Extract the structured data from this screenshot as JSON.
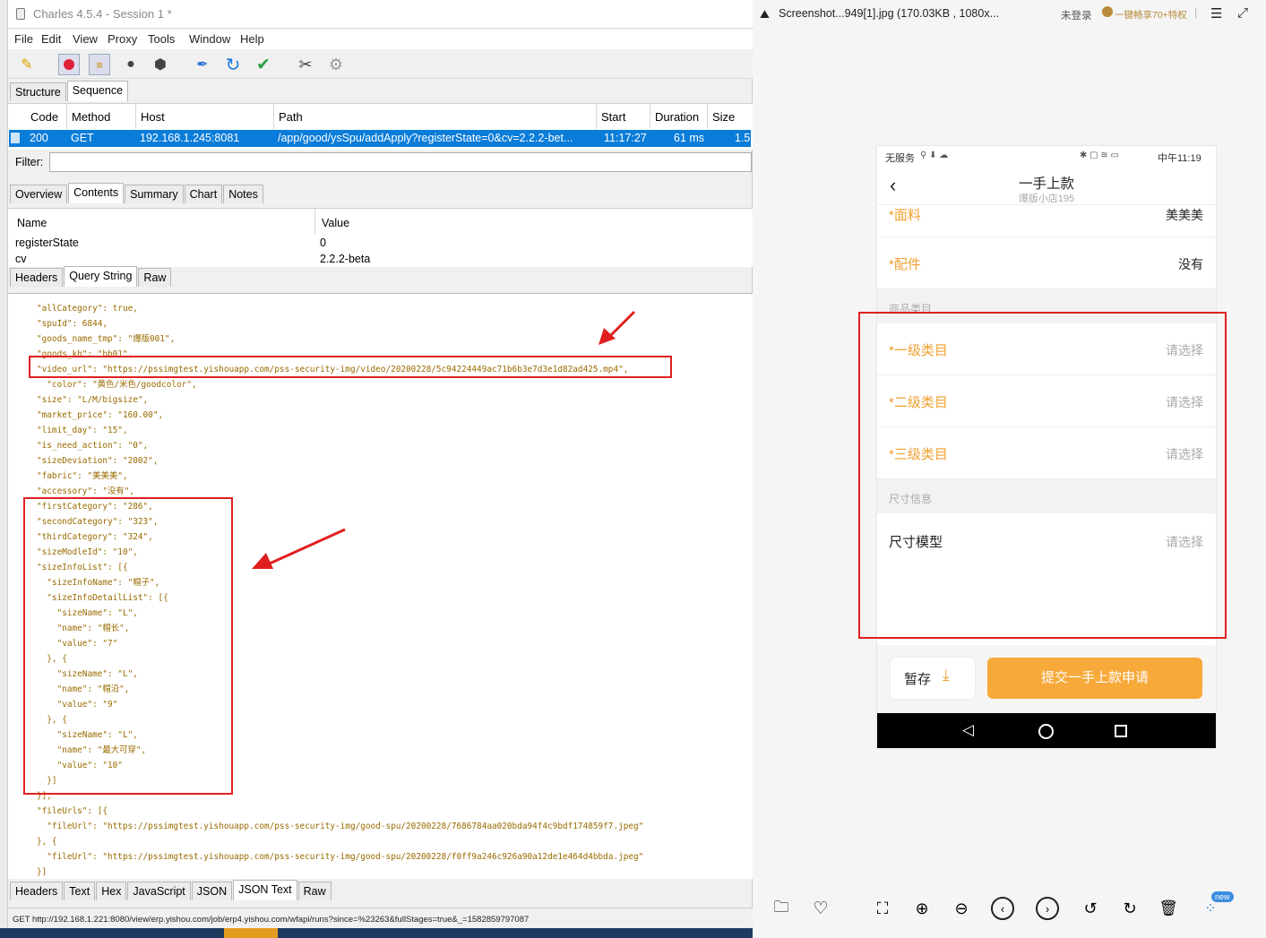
{
  "window": {
    "title": "Charles 4.5.4 - Session 1 *"
  },
  "menu": [
    "File",
    "Edit",
    "View",
    "Proxy",
    "Tools",
    "Window",
    "Help"
  ],
  "view_tabs": [
    "Structure",
    "Sequence"
  ],
  "columns": [
    "Code",
    "Method",
    "Host",
    "Path",
    "Start",
    "Duration",
    "Size"
  ],
  "request": {
    "code": "200",
    "method": "GET",
    "host": "192.168.1.245:8081",
    "path": "/app/good/ysSpu/addApply?registerState=0&cv=2.2.2-bet...",
    "start": "11:17:27",
    "duration": "61 ms",
    "size": "1.5"
  },
  "filter": {
    "label": "Filter:",
    "value": ""
  },
  "detail_tabs": [
    "Overview",
    "Contents",
    "Summary",
    "Chart",
    "Notes"
  ],
  "params": {
    "col_name": "Name",
    "col_value": "Value",
    "rows": [
      {
        "name": "registerState",
        "value": "0"
      },
      {
        "name": "cv",
        "value": "2.2.2-beta"
      }
    ]
  },
  "request_tabs": [
    "Headers",
    "Query String",
    "Raw"
  ],
  "json_lines": [
    "\"allCategory\": true,",
    "\"spuId\": 6844,",
    "\"goods_name_tmp\": \"爆版001\",",
    "\"goods_kh\": \"bb01\",",
    "\"video_url\": \"https://pssimgtest.yishouapp.com/pss-security-img/video/20200228/5c94224449ac71b6b3e7d3e1d82ad425.mp4\",",
    "  \"color\": \"黄色/米色/goodcolor\",",
    "\"size\": \"L/M/bigsize\",",
    "\"market_price\": \"160.00\",",
    "\"limit_day\": \"15\",",
    "\"is_need_action\": \"0\",",
    "\"sizeDeviation\": \"2002\",",
    "\"fabric\": \"美美美\",",
    "\"accessory\": \"没有\",",
    "\"firstCategory\": \"286\",",
    "\"secondCategory\": \"323\",",
    "\"thirdCategory\": \"324\",",
    "\"sizeModleId\": \"10\",",
    "\"sizeInfoList\": [{",
    "  \"sizeInfoName\": \"帽子\",",
    "  \"sizeInfoDetailList\": [{",
    "    \"sizeName\": \"L\",",
    "    \"name\": \"帽长\",",
    "    \"value\": \"7\"",
    "  }, {",
    "    \"sizeName\": \"L\",",
    "    \"name\": \"帽沿\",",
    "    \"value\": \"9\"",
    "  }, {",
    "    \"sizeName\": \"L\",",
    "    \"name\": \"最大可穿\",",
    "    \"value\": \"10\"",
    "  }]",
    "}],",
    "\"fileUrls\": [{",
    "  \"fileUrl\": \"https://pssimgtest.yishouapp.com/pss-security-img/good-spu/20200228/7686784aa020bda94f4c9bdf174859f7.jpeg\"",
    "}, {",
    "  \"fileUrl\": \"https://pssimgtest.yishouapp.com/pss-security-img/good-spu/20200228/f0ff9a246c926a90a12de1e464d4bbda.jpeg\"",
    "}]"
  ],
  "body_tabs": [
    "Headers",
    "Text",
    "Hex",
    "JavaScript",
    "JSON",
    "JSON Text",
    "Raw"
  ],
  "status_line": "GET http://192.168.1.221:8080/view/erp.yishou.com/job/erp4.yishou.com/wfapi/runs?since=%23263&fullStages=true&_=1582859797087",
  "viewer": {
    "file": "Screenshot...949[1].jpg (170.03KB , 1080x...",
    "login": "未登录",
    "promo": "一键畅享70+特权"
  },
  "phone": {
    "status_left": "无服务",
    "time": "中午11:19",
    "title": "一手上款",
    "subtitle": "爆版小店195",
    "fabric_label": "*面料",
    "fabric_value": "美美美",
    "accessory_label": "*配件",
    "accessory_value": "没有",
    "section_category": "商品类目",
    "cat1": "*一级类目",
    "cat2": "*二级类目",
    "cat3": "*三级类目",
    "choose": "请选择",
    "section_size": "尺寸信息",
    "size_model": "尺寸模型",
    "save": "暂存",
    "submit": "提交一手上款申请"
  },
  "colors": {
    "accent": "#f0a030",
    "selection": "#0a7cd9",
    "highlight": "#e02020"
  }
}
